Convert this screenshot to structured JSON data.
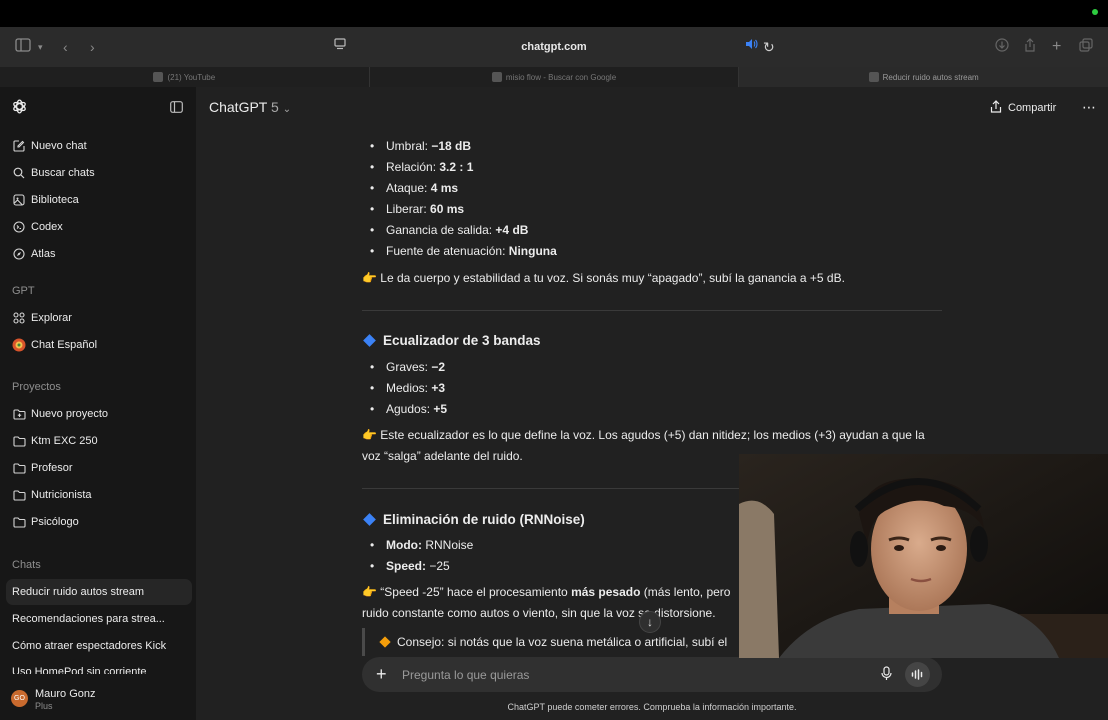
{
  "browser": {
    "url": "chatgpt.com",
    "tabs": [
      {
        "label": "(21) YouTube"
      },
      {
        "label": "misio flow - Buscar con Google"
      },
      {
        "label": "Reducir ruido autos stream"
      }
    ]
  },
  "sidebar": {
    "nav": [
      {
        "label": "Nuevo chat",
        "icon": "edit-icon"
      },
      {
        "label": "Buscar chats",
        "icon": "search-icon"
      },
      {
        "label": "Biblioteca",
        "icon": "library-icon"
      },
      {
        "label": "Codex",
        "icon": "codex-icon"
      },
      {
        "label": "Atlas",
        "icon": "compass-icon"
      }
    ],
    "gpt_section": "GPT",
    "gpts": [
      {
        "label": "Explorar",
        "icon": "grid-icon"
      },
      {
        "label": "Chat Español",
        "icon": "gpt-avatar-icon"
      }
    ],
    "projects_section": "Proyectos",
    "projects": [
      {
        "label": "Nuevo proyecto",
        "icon": "new-folder-icon"
      },
      {
        "label": "Ktm EXC 250",
        "icon": "folder-icon"
      },
      {
        "label": "Profesor",
        "icon": "folder-icon"
      },
      {
        "label": "Nutricionista",
        "icon": "folder-icon"
      },
      {
        "label": "Psicólogo",
        "icon": "folder-icon"
      }
    ],
    "chats_section": "Chats",
    "chats": [
      {
        "label": "Reducir ruido autos stream"
      },
      {
        "label": "Recomendaciones para strea..."
      },
      {
        "label": "Cómo atraer espectadores Kick"
      },
      {
        "label": "Uso HomePod sin corriente"
      }
    ],
    "user": {
      "initials": "GO",
      "name": "Mauro Gonz",
      "plan": "Plus"
    }
  },
  "header": {
    "model": "ChatGPT",
    "version": "5",
    "share_label": "Compartir"
  },
  "message": {
    "compressor_items": [
      {
        "label": "Umbral:",
        "value": "−18 dB"
      },
      {
        "label": "Relación:",
        "value": "3.2 : 1"
      },
      {
        "label": "Ataque:",
        "value": "4 ms"
      },
      {
        "label": "Liberar:",
        "value": "60 ms"
      },
      {
        "label": "Ganancia de salida:",
        "value": "+4 dB"
      },
      {
        "label": "Fuente de atenuación:",
        "value": "Ninguna"
      }
    ],
    "compressor_note": "👉 Le da cuerpo y estabilidad a tu voz. Si sonás muy “apagado”, subí la ganancia a +5 dB.",
    "eq_title": "Ecualizador de 3 bandas",
    "eq_items": [
      {
        "label": "Graves:",
        "value": "−2"
      },
      {
        "label": "Medios:",
        "value": "+3"
      },
      {
        "label": "Agudos:",
        "value": "+5"
      }
    ],
    "eq_note": "👉 Este ecualizador es lo que define la voz. Los agudos (+5) dan nitidez; los medios (+3) ayudan a que la voz “salga” adelante del ruido.",
    "noise_title": "Eliminación de ruido (RNNoise)",
    "noise_items": [
      {
        "label": "Modo:",
        "value": "RNNoise"
      },
      {
        "label": "Speed:",
        "value": "−25"
      }
    ],
    "noise_note_a": "👉 “Speed -25” hace el procesamiento ",
    "noise_note_b": "más pesado",
    "noise_note_c": " (más lento, pero",
    "noise_note_line2": "ruido constante como autos o viento, sin que la voz se distorsione.",
    "tip": "Consejo: si notás que la voz suena metálica o artificial, subí el"
  },
  "composer": {
    "placeholder": "Pregunta lo que quieras"
  },
  "disclaimer": "ChatGPT puede cometer errores. Comprueba la información importante."
}
